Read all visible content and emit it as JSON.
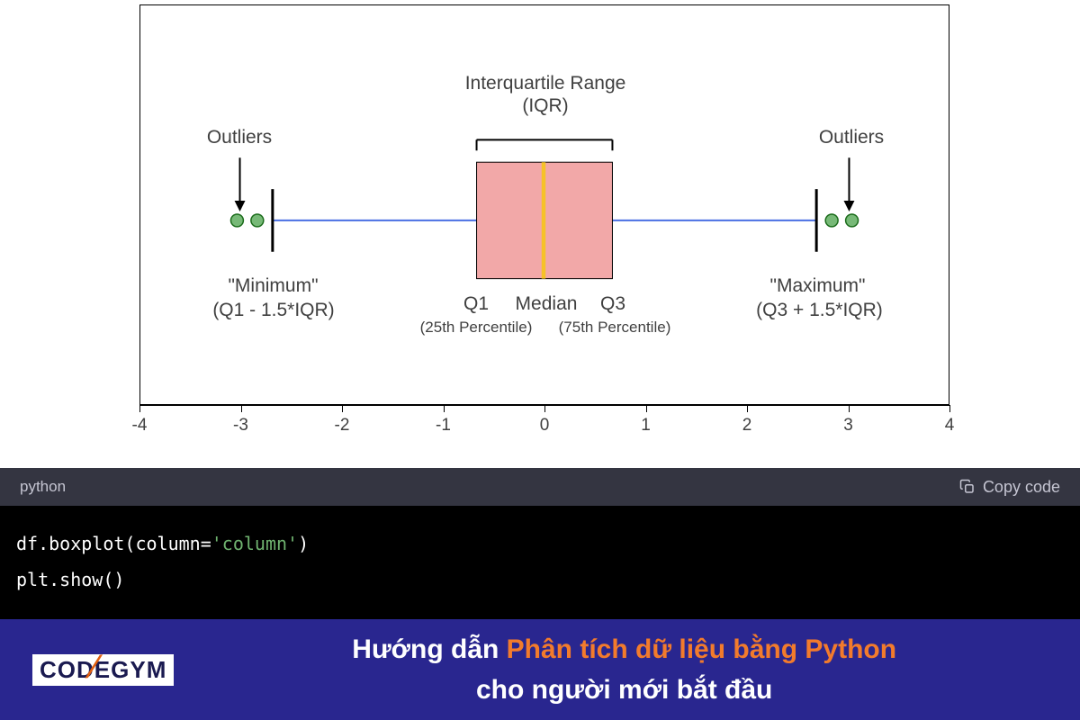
{
  "chart_data": {
    "type": "boxplot",
    "xlim": [
      -4,
      4
    ],
    "ticks": [
      -4,
      -3,
      -2,
      -1,
      0,
      1,
      2,
      3,
      4
    ],
    "q1": -0.674,
    "median": 0,
    "q3": 0.674,
    "whisker_low": -2.698,
    "whisker_high": 2.698,
    "outliers_low": [
      -3.05,
      -2.85
    ],
    "outliers_high": [
      2.85,
      3.05
    ],
    "labels": {
      "iqr_top": "Interquartile Range",
      "iqr_sub": "(IQR)",
      "outliers_left": "Outliers",
      "outliers_right": "Outliers",
      "min_title": "\"Minimum\"",
      "min_formula": "(Q1 - 1.5*IQR)",
      "max_title": "\"Maximum\"",
      "max_formula": "(Q3 + 1.5*IQR)",
      "q1": "Q1",
      "q1_sub": "(25th Percentile)",
      "median": "Median",
      "q3": "Q3",
      "q3_sub": "(75th Percentile)"
    }
  },
  "code": {
    "language": "python",
    "copy_label": "Copy code",
    "line1_pre": "df.boxplot(column=",
    "line1_str": "'column'",
    "line1_post": ")",
    "line2": "plt.show()"
  },
  "banner": {
    "logo_code": "CODE",
    "logo_gym": "GYM",
    "text_prefix": "Hướng dẫn ",
    "text_highlight": "Phân tích dữ liệu bằng Python",
    "text_suffix": "cho người mới bắt đầu"
  }
}
